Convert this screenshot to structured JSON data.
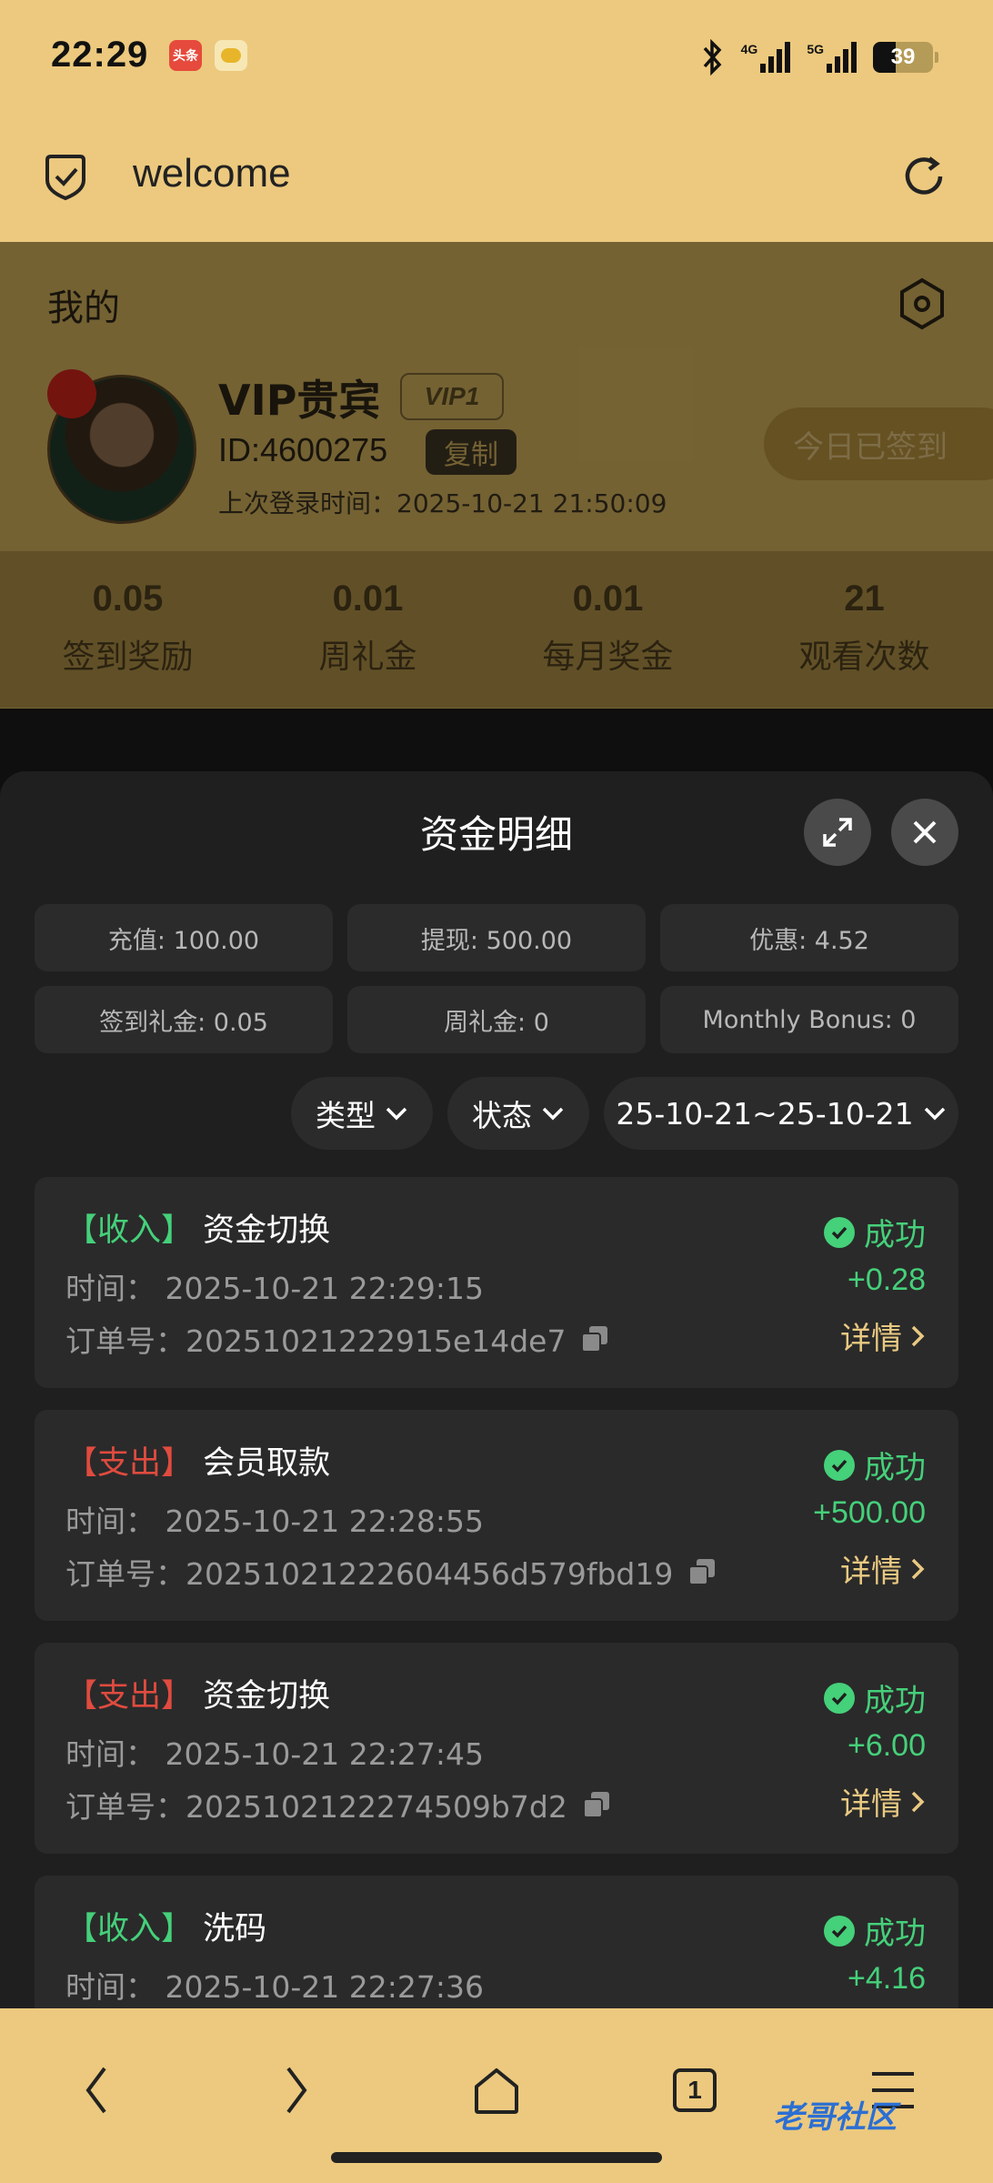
{
  "status_bar": {
    "time": "22:29",
    "notif1": "头条",
    "battery": "39",
    "net1": "4G",
    "net2": "5G"
  },
  "browser": {
    "url_text": "welcome"
  },
  "profile": {
    "title": "我的",
    "name": "VIP贵宾",
    "vip_badge": "VIP1",
    "id": "ID:4600275",
    "copy_label": "复制",
    "last_login_label": "上次登录时间：",
    "last_login_value": "2025-10-21 21:50:09",
    "signed_label": "今日已签到",
    "stats": [
      {
        "value": "0.05",
        "label": "签到奖励"
      },
      {
        "value": "0.01",
        "label": "周礼金"
      },
      {
        "value": "0.01",
        "label": "每月奖金"
      },
      {
        "value": "21",
        "label": "观看次数"
      }
    ]
  },
  "sheet": {
    "title": "资金明细",
    "summary": [
      "充值: 100.00",
      "提现: 500.00",
      "优惠: 4.52",
      "签到礼金: 0.05",
      "周礼金: 0",
      "Monthly Bonus: 0"
    ],
    "filters": {
      "type": "类型",
      "status": "状态",
      "date": "25-10-21~25-10-21"
    },
    "records": [
      {
        "direction": "【收入】",
        "direction_kind": "in",
        "name": "资金切换",
        "time_label": "时间：",
        "time": "2025-10-21 22:29:15",
        "order_label": "订单号：",
        "order": "20251021222915e14de7",
        "status": "成功",
        "amount": "+0.28",
        "detail": "详情"
      },
      {
        "direction": "【支出】",
        "direction_kind": "out",
        "name": "会员取款",
        "time_label": "时间：",
        "time": "2025-10-21 22:28:55",
        "order_label": "订单号：",
        "order": "20251021222604456d579fbd19",
        "status": "成功",
        "amount": "+500.00",
        "detail": "详情"
      },
      {
        "direction": "【支出】",
        "direction_kind": "out",
        "name": "资金切换",
        "time_label": "时间：",
        "time": "2025-10-21 22:27:45",
        "order_label": "订单号：",
        "order": "2025102122274509b7d2",
        "status": "成功",
        "amount": "+6.00",
        "detail": "详情"
      },
      {
        "direction": "【收入】",
        "direction_kind": "in",
        "name": "洗码",
        "time_label": "时间：",
        "time": "2025-10-21 22:27:36",
        "status": "成功",
        "amount": "+4.16"
      }
    ]
  },
  "nav": {
    "tab_count": "1"
  },
  "watermark": "老哥社区",
  "colors": {
    "gold": "#ecc97e",
    "income": "#45d07a",
    "expense": "#e04b3f",
    "detail": "#e9c982"
  }
}
